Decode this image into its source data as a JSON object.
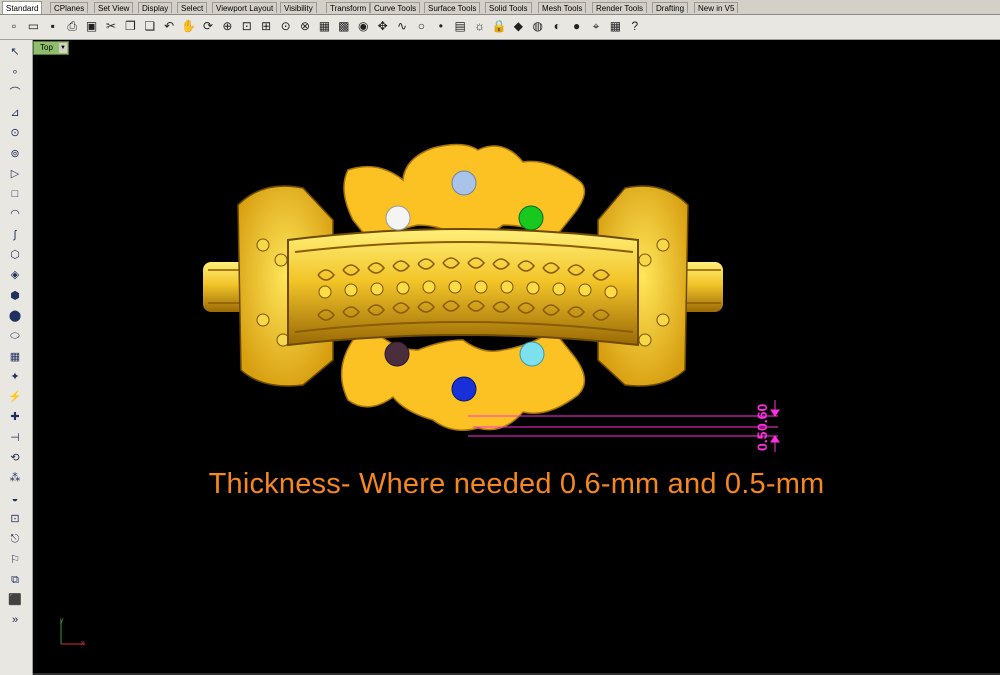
{
  "tabs": [
    "Standard",
    "CPlanes",
    "Set View",
    "Display",
    "Select",
    "Viewport Layout",
    "Visibility",
    "Transform",
    "Curve Tools",
    "Surface Tools",
    "Solid Tools",
    "Mesh Tools",
    "Render Tools",
    "Drafting",
    "New in V5"
  ],
  "active_tab": "Standard",
  "viewport": {
    "title": "Top"
  },
  "caption": "Thickness- Where needed 0.6-mm and 0.5-mm",
  "dimensions": {
    "first": "0.60",
    "second": "0.5"
  },
  "axes": {
    "x": "x",
    "y": "y"
  },
  "colors": {
    "dimension": "#ff2fe0",
    "caption": "#f5871f",
    "viewport_bg": "#000000",
    "gold": "#e6b41e"
  },
  "gems": [
    "white",
    "light-blue",
    "green",
    "dark-purple",
    "cyan",
    "blue"
  ],
  "toolbar_icons": [
    "new-file-icon",
    "open-file-icon",
    "save-icon",
    "print-icon",
    "import-icon",
    "cut-icon",
    "copy-icon",
    "paste-icon",
    "undo-icon",
    "pan-icon",
    "rotate-view-icon",
    "zoom-icon",
    "zoom-window-icon",
    "zoom-extents-icon",
    "zoom-selected-icon",
    "zoom-dynamic-icon",
    "viewport-layout-icon",
    "four-views-icon",
    "camera-icon",
    "move-icon",
    "curve-icon",
    "circle-icon",
    "point-icon",
    "surface-icon",
    "lightbulb-icon",
    "lock-icon",
    "render-icon",
    "color-wheel-icon",
    "material-icon",
    "sphere-icon",
    "osnap-icon",
    "grid-icon",
    "help-icon"
  ],
  "left_tools": [
    "select-arrow-icon",
    "point-icon",
    "polyline-icon",
    "curve-edit-icon",
    "circle-icon",
    "ellipse-icon",
    "polygon-icon",
    "rectangle-icon",
    "arc-icon",
    "freeform-curve-icon",
    "extrude-icon",
    "surface-patch-icon",
    "box-solid-icon",
    "boolean-icon",
    "cylinder-icon",
    "mesh-icon",
    "explode-icon",
    "join-icon",
    "trim-icon",
    "split-icon",
    "transform-icon",
    "array-icon",
    "fillet-icon",
    "text-icon",
    "dimension-icon",
    "layers-icon",
    "mirror-icon",
    "solid-box-icon",
    "more-tools-icon"
  ]
}
